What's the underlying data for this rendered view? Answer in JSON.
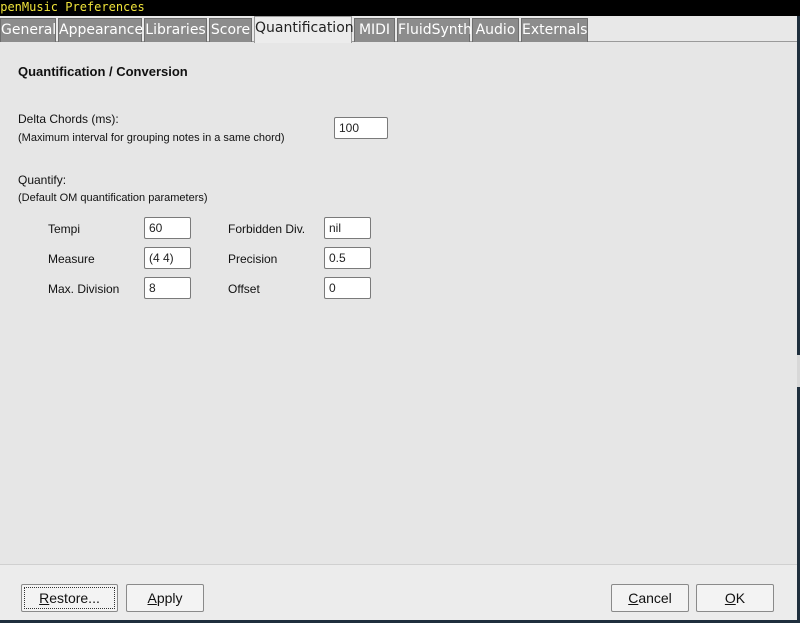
{
  "window": {
    "title": "OpenMusic Preferences"
  },
  "tabs": [
    {
      "label": "General",
      "active": false
    },
    {
      "label": "Appearance",
      "active": false
    },
    {
      "label": "Libraries",
      "active": false
    },
    {
      "label": "Score",
      "active": false
    },
    {
      "label": "Quantification",
      "active": true
    },
    {
      "label": "MIDI",
      "active": false
    },
    {
      "label": "FluidSynth",
      "active": false
    },
    {
      "label": "Audio",
      "active": false
    },
    {
      "label": "Externals",
      "active": false
    }
  ],
  "panel": {
    "title": "Quantification / Conversion",
    "delta_chords": {
      "label": "Delta Chords (ms):",
      "note": "(Maximum interval for grouping notes in a same chord)",
      "value": "100"
    },
    "quantify": {
      "label": "Quantify:",
      "note": "(Default OM quantification parameters)",
      "tempi": {
        "label": "Tempi",
        "value": "60"
      },
      "measure": {
        "label": "Measure",
        "value": "(4 4)"
      },
      "max_division": {
        "label": "Max. Division",
        "value": "8"
      },
      "forbidden_div": {
        "label": "Forbidden Div.",
        "value": "nil"
      },
      "precision": {
        "label": "Precision",
        "value": "0.5"
      },
      "offset": {
        "label": "Offset",
        "value": "0"
      }
    }
  },
  "buttons": {
    "restore": {
      "mnemonic": "R",
      "rest": "estore..."
    },
    "apply": {
      "mnemonic": "A",
      "rest": "pply"
    },
    "cancel": {
      "mnemonic": "C",
      "rest": "ancel"
    },
    "ok": {
      "mnemonic": "O",
      "rest": "K"
    }
  },
  "colors": {
    "title_text": "#f0e33a",
    "tab_inactive": "#8c8c8c",
    "panel_bg": "#e6e6e6"
  }
}
